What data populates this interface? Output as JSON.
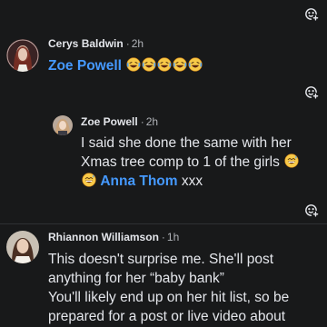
{
  "comments": [
    {
      "author": "Cerys Baldwin",
      "time": "2h",
      "mention": "Zoe Powell",
      "emoji": [
        "laughing-crying-emoji",
        "laughing-crying-emoji",
        "laughing-crying-emoji",
        "laughing-crying-emoji",
        "laughing-crying-emoji"
      ]
    },
    {
      "author": "Zoe Powell",
      "time": "2h",
      "lines": [
        "I said she done the same with her",
        "Xmas tree comp to 1 of the girls"
      ],
      "mention": "Anna Thom",
      "suffix": "xxx",
      "emoji": [
        "grinning-sweat-emoji",
        "grinning-sweat-emoji"
      ]
    },
    {
      "author": "Rhiannon Williamson",
      "time": "1h",
      "lines": [
        "This doesn't surprise me. She'll post",
        "anything for her “baby bank”",
        "You'll likely end up on her hit list, so be",
        "prepared for a post or live video about"
      ]
    }
  ],
  "separator": "·",
  "icons": {
    "reaction": "add-reaction-icon"
  },
  "colors": {
    "background": "#18191a",
    "text": "#e4e6eb",
    "muted": "#b0b3b8",
    "mention": "#4599ff"
  }
}
